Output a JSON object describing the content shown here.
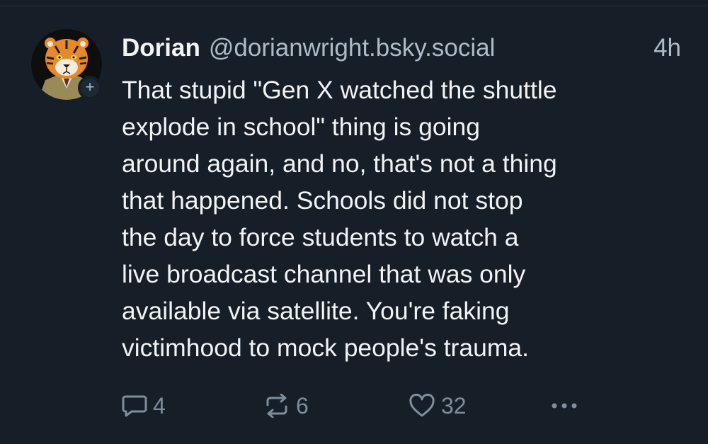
{
  "post": {
    "author": {
      "display_name": "Dorian",
      "handle": "@dorianwright.bsky.social",
      "avatar_icon": "tiger-avatar"
    },
    "timestamp": "4h",
    "text_lines": [
      "That stupid \"Gen X watched the shuttle",
      "explode in school\" thing is going",
      "around again, and no, that's not a thing",
      "that happened. Schools did not stop",
      "the day to force students to watch a",
      "live broadcast channel that was only",
      "available via satellite. You're faking",
      "victimhood to mock people's trauma."
    ],
    "actions": {
      "reply_count": "4",
      "repost_count": "6",
      "like_count": "32"
    }
  },
  "icons": {
    "reply": "speech-bubble-icon",
    "repost": "repost-arrows-icon",
    "like": "heart-icon",
    "more": "ellipsis-icon",
    "follow": "plus-icon"
  },
  "colors": {
    "background": "#161e27",
    "text_primary": "#f1f3f5",
    "text_secondary": "#aebbc9",
    "action_icon": "#7f8d9c"
  }
}
